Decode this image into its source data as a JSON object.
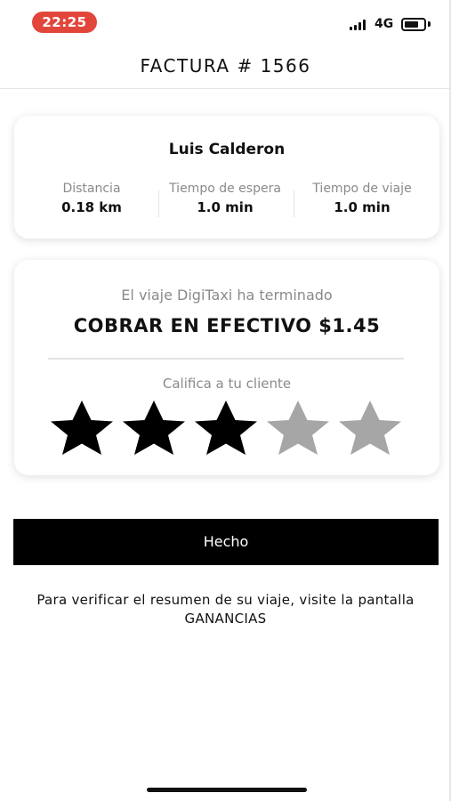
{
  "status_bar": {
    "time": "22:25",
    "network": "4G",
    "time_pill_color": "#e2463b"
  },
  "header": {
    "title": "FACTURA # 1566"
  },
  "rider": {
    "name": "Luis Calderon",
    "stats": [
      {
        "label": "Distancia",
        "value": "0.18 km"
      },
      {
        "label": "Tiempo de espera",
        "value": "1.0 min"
      },
      {
        "label": "Tiempo de viaje",
        "value": "1.0 min"
      }
    ]
  },
  "trip": {
    "status": "El viaje DigiTaxi ha terminado",
    "amount": "COBRAR EN EFECTIVO $1.45",
    "rating_label": "Califica a tu cliente",
    "rating": {
      "value": 3,
      "max": 5
    },
    "star_filled_color": "#000000",
    "star_empty_color": "#a6a6a6"
  },
  "actions": {
    "done_label": "Hecho"
  },
  "footer": {
    "note": "Para verificar el resumen de su viaje, visite la pantalla GANANCIAS"
  }
}
